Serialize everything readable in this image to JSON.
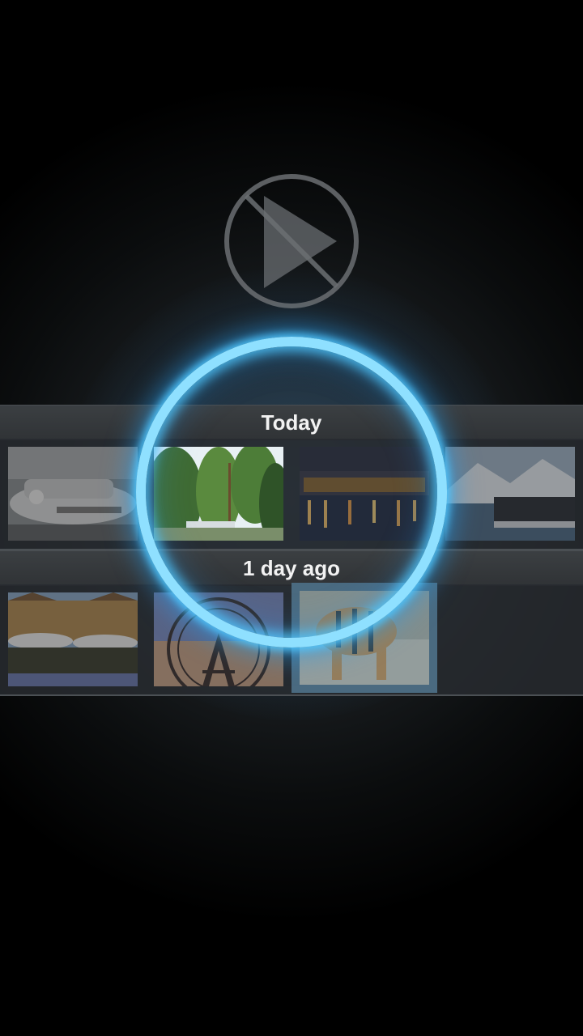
{
  "sections": [
    {
      "label": "Today"
    },
    {
      "label": "1 day ago"
    }
  ],
  "icons": {
    "play_disabled": "play-disabled-icon"
  },
  "colors": {
    "ring": "#5fd0ff",
    "header_bg": "#35393c",
    "selected_tile": "#4a6a80"
  }
}
